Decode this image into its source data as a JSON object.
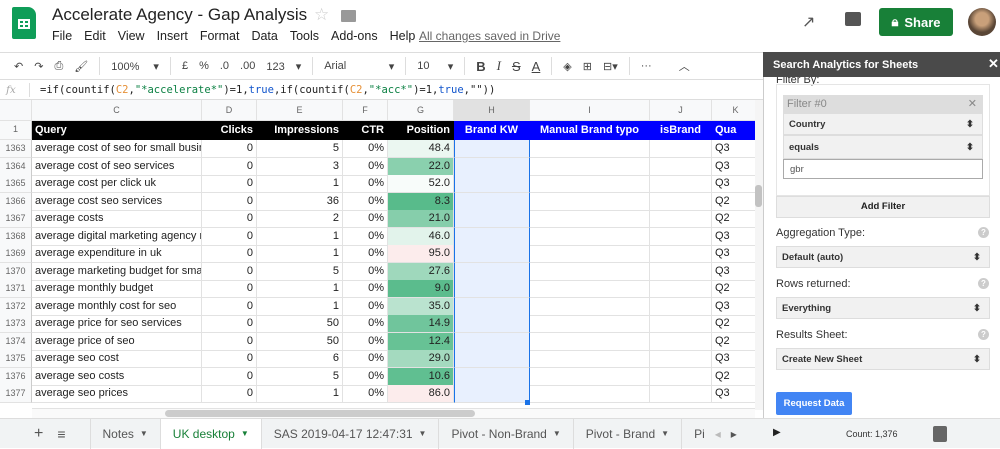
{
  "app": {
    "title": "Accelerate Agency - Gap Analysis",
    "menu": [
      "File",
      "Edit",
      "View",
      "Insert",
      "Format",
      "Data",
      "Tools",
      "Add-ons",
      "Help"
    ],
    "saved_status": "All changes saved in Drive",
    "share_label": "Share"
  },
  "toolbar": {
    "zoom": "100%",
    "currency": "£",
    "percent": "%",
    "dec_less": ".0",
    "dec_more": ".00",
    "format": "123",
    "font": "Arial",
    "font_size": "10",
    "bold": "B",
    "italic": "I",
    "strike": "S",
    "text_color": "A"
  },
  "formula": {
    "fx": "fx",
    "p1": "=if(countif(",
    "r1": "C2",
    "p2": ",",
    "s1": "\"*accelerate*\"",
    "p3": ")=1,",
    "t1": "true",
    "p4": ",if(countif(",
    "r2": "C2",
    "p5": ",",
    "s2": "\"*acc*\"",
    "p6": ")=1,",
    "t2": "true",
    "p7": ",\"\"))"
  },
  "columns": [
    "C",
    "D",
    "E",
    "F",
    "G",
    "H",
    "I",
    "J",
    "K"
  ],
  "header_row": {
    "num": "1",
    "cells": [
      "Query",
      "Clicks",
      "Impressions",
      "CTR",
      "Position",
      "Brand KW",
      "Manual Brand typo",
      "isBrand",
      "Qua"
    ]
  },
  "rows": [
    {
      "n": "1363",
      "q": "average cost of seo for small busin",
      "c": "0",
      "i": "5",
      "ctr": "0%",
      "p": "48.4",
      "k": "Q3"
    },
    {
      "n": "1364",
      "q": "average cost of seo services",
      "c": "0",
      "i": "3",
      "ctr": "0%",
      "p": "22.0",
      "k": "Q3"
    },
    {
      "n": "1365",
      "q": "average cost per click uk",
      "c": "0",
      "i": "1",
      "ctr": "0%",
      "p": "52.0",
      "k": "Q3"
    },
    {
      "n": "1366",
      "q": "average cost seo services",
      "c": "0",
      "i": "36",
      "ctr": "0%",
      "p": "8.3",
      "k": "Q2"
    },
    {
      "n": "1367",
      "q": "average costs",
      "c": "0",
      "i": "2",
      "ctr": "0%",
      "p": "21.0",
      "k": "Q2"
    },
    {
      "n": "1368",
      "q": "average digital marketing agency re",
      "c": "0",
      "i": "1",
      "ctr": "0%",
      "p": "46.0",
      "k": "Q3"
    },
    {
      "n": "1369",
      "q": "average expenditure in uk",
      "c": "0",
      "i": "1",
      "ctr": "0%",
      "p": "95.0",
      "k": "Q3"
    },
    {
      "n": "1370",
      "q": "average marketing budget for small",
      "c": "0",
      "i": "5",
      "ctr": "0%",
      "p": "27.6",
      "k": "Q3"
    },
    {
      "n": "1371",
      "q": "average monthly budget",
      "c": "0",
      "i": "1",
      "ctr": "0%",
      "p": "9.0",
      "k": "Q2"
    },
    {
      "n": "1372",
      "q": "average monthly cost for seo",
      "c": "0",
      "i": "1",
      "ctr": "0%",
      "p": "35.0",
      "k": "Q3"
    },
    {
      "n": "1373",
      "q": "average price for seo services",
      "c": "0",
      "i": "50",
      "ctr": "0%",
      "p": "14.9",
      "k": "Q2"
    },
    {
      "n": "1374",
      "q": "average price of seo",
      "c": "0",
      "i": "50",
      "ctr": "0%",
      "p": "12.4",
      "k": "Q2"
    },
    {
      "n": "1375",
      "q": "average seo cost",
      "c": "0",
      "i": "6",
      "ctr": "0%",
      "p": "29.0",
      "k": "Q3"
    },
    {
      "n": "1376",
      "q": "average seo costs",
      "c": "0",
      "i": "5",
      "ctr": "0%",
      "p": "10.6",
      "k": "Q2"
    },
    {
      "n": "1377",
      "q": "average seo prices",
      "c": "0",
      "i": "1",
      "ctr": "0%",
      "p": "86.0",
      "k": "Q3"
    }
  ],
  "tabs": [
    {
      "label": "Notes"
    },
    {
      "label": "UK desktop",
      "active": true
    },
    {
      "label": "SAS 2019-04-17 12:47:31"
    },
    {
      "label": "Pivot - Non-Brand"
    },
    {
      "label": "Pivot - Brand"
    },
    {
      "label": "Pi"
    }
  ],
  "sidebar": {
    "title": "Search Analytics for Sheets",
    "filter_by": "Filter By:",
    "filter_title": "Filter #0",
    "dimension": "Country",
    "operator": "equals",
    "value": "gbr",
    "add_filter": "Add Filter",
    "aggregation_label": "Aggregation Type:",
    "aggregation": "Default (auto)",
    "rows_label": "Rows returned:",
    "rows": "Everything",
    "results_label": "Results Sheet:",
    "results": "Create New Sheet",
    "request": "Request Data",
    "help": "?"
  },
  "status": {
    "count": "Count: 1,376"
  },
  "colors": {
    "header_black": "#000000",
    "header_blue": "#0000ff",
    "accent_green": "#188038",
    "selection": "#e8f0fe",
    "request_blue": "#4285f4"
  }
}
